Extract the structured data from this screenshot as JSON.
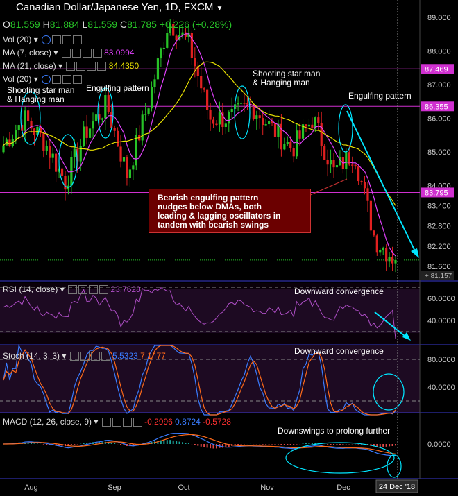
{
  "header": {
    "title": "Canadian Dollar/Japanese Yen, 1D, FXCM",
    "ohlc": {
      "o_label": "O",
      "o": "81.559",
      "h_label": "H",
      "h": "81.884",
      "l_label": "L",
      "l": "81.559",
      "c_label": "C",
      "c": "81.785",
      "change": "+0.226 (+0.28%)"
    }
  },
  "indicators": [
    {
      "label": "Vol (20)",
      "value": ""
    },
    {
      "label": "MA (7, close)",
      "value": "83.0994",
      "color": "#e040fb"
    },
    {
      "label": "MA (21, close)",
      "value": "84.4350",
      "color": "#e8e000"
    },
    {
      "label": "Vol (20)",
      "value": ""
    }
  ],
  "colors": {
    "up": "#27c227",
    "down": "#e02020",
    "ma7": "#e040fb",
    "ma21": "#e8e000",
    "rsi": "#b04fc8",
    "stoch_k": "#3a7cff",
    "stoch_d": "#ff6a1a",
    "macd": "#3a7cff",
    "signal": "#ff6a1a",
    "level_line": "#d030d0",
    "cyan": "#00e5ff"
  },
  "price_axis": {
    "ticks": [
      "89.000",
      "88.000",
      "87.000",
      "86.000",
      "85.000",
      "84.000",
      "83.400",
      "82.800",
      "82.200",
      "81.600"
    ],
    "highlight_levels": [
      {
        "label": "87.469",
        "value": 87.469
      },
      {
        "label": "86.355",
        "value": 86.355
      },
      {
        "label": "83.795",
        "value": 83.795
      }
    ],
    "last_price": "81.157"
  },
  "annotations": {
    "shooting_star_left": "Shooting star man\n& Hanging man",
    "engulfing_left": "Engulfing pattern",
    "shooting_star_mid": "Shooting star man\n& Hanging man",
    "engulfing_right": "Engulfing pattern",
    "callout": "Bearish engulfing pattern\nnudges below DMAs, both\nleading & lagging oscillators in\ntandem with bearish swings",
    "rsi_note": "Downward convergence",
    "stoch_note": "Downward convergence",
    "macd_note": "Downswings to prolong further"
  },
  "rsi": {
    "label": "RSI (14, close)",
    "value": "23.7628",
    "ticks": [
      "60.0000",
      "40.0000"
    ]
  },
  "stoch": {
    "label": "Stoch (14, 3, 3)",
    "k": "5.5323",
    "d": "7.1477",
    "ticks": [
      "80.0000",
      "40.0000"
    ]
  },
  "macd": {
    "label": "MACD (12, 26, close, 9)",
    "macd": "-0.2996",
    "signal": "0.8724",
    "hist": "-0.5728",
    "ticks": [
      "0.0000"
    ]
  },
  "time_axis": {
    "labels": [
      "Aug",
      "Sep",
      "Oct",
      "Nov",
      "Dec"
    ],
    "cursor_label": "24 Dec '18"
  },
  "chart_data": {
    "type": "candlestick",
    "title": "Canadian Dollar/Japanese Yen, 1D, FXCM",
    "ylim": [
      81.1,
      89.3
    ],
    "price_path_approx": [
      {
        "x": "Jul",
        "close": 85.2
      },
      {
        "x": "Jul (late)",
        "close": 86.0
      },
      {
        "x": "Aug",
        "close": 85.3
      },
      {
        "x": "Aug (mid)",
        "close": 84.1
      },
      {
        "x": "Aug (late)",
        "close": 85.6
      },
      {
        "x": "Sep",
        "close": 86.4
      },
      {
        "x": "Sep (mid)",
        "close": 84.3
      },
      {
        "x": "Sep (late)",
        "close": 86.4
      },
      {
        "x": "Oct",
        "close": 88.9
      },
      {
        "x": "Oct (early)",
        "close": 88.2
      },
      {
        "x": "Oct (mid)",
        "close": 86.0
      },
      {
        "x": "Oct (late)",
        "close": 86.0
      },
      {
        "x": "Nov",
        "close": 86.4
      },
      {
        "x": "Nov (mid)",
        "close": 85.7
      },
      {
        "x": "Nov (late)",
        "close": 85.1
      },
      {
        "x": "Dec",
        "close": 86.0
      },
      {
        "x": "Dec (early)",
        "close": 84.4
      },
      {
        "x": "Dec (mid)",
        "close": 85.0
      },
      {
        "x": "Dec (late)",
        "close": 82.4
      },
      {
        "x": "24 Dec '18",
        "close": 81.785
      }
    ],
    "ma7_last": 83.0994,
    "ma21_last": 84.435,
    "horizontal_levels": [
      87.469,
      86.355,
      83.795
    ]
  }
}
